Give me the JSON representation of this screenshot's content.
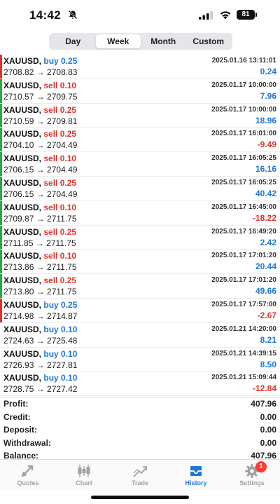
{
  "status_bar": {
    "time": "14:42",
    "battery": "81"
  },
  "period_tabs": [
    "Day",
    "Week",
    "Month",
    "Custom"
  ],
  "active_period": "Week",
  "colors": {
    "buy": "#1e78d6",
    "sell": "#e0322b",
    "profit_positive": "#1e78d6",
    "profit_negative": "#e0322b",
    "bar_green": "#2aa84a",
    "bar_red": "#e0322b",
    "active_tab": "#1e78d6"
  },
  "trades": [
    {
      "symbol": "XAUUSD,",
      "side": "buy",
      "volume": "0.25",
      "prices": "2708.82 → 2708.83",
      "time": "2025.01.16 13:11:01",
      "profit": "0.24",
      "bar": "red"
    },
    {
      "symbol": "XAUUSD,",
      "side": "sell",
      "volume": "0.10",
      "prices": "2710.57 → 2709.75",
      "time": "2025.01.17 10:00:00",
      "profit": "7.96",
      "bar": "green"
    },
    {
      "symbol": "XAUUSD,",
      "side": "sell",
      "volume": "0.25",
      "prices": "2710.59 → 2709.81",
      "time": "2025.01.17 10:00:00",
      "profit": "18.96",
      "bar": "green"
    },
    {
      "symbol": "XAUUSD,",
      "side": "sell",
      "volume": "0.25",
      "prices": "2704.10 → 2704.49",
      "time": "2025.01.17 16:01:00",
      "profit": "-9.49",
      "bar": "green"
    },
    {
      "symbol": "XAUUSD,",
      "side": "sell",
      "volume": "0.10",
      "prices": "2706.15 → 2704.49",
      "time": "2025.01.17 16:05:25",
      "profit": "16.16",
      "bar": "green"
    },
    {
      "symbol": "XAUUSD,",
      "side": "sell",
      "volume": "0.25",
      "prices": "2706.15 → 2704.49",
      "time": "2025.01.17 16:05:25",
      "profit": "40.42",
      "bar": "green"
    },
    {
      "symbol": "XAUUSD,",
      "side": "sell",
      "volume": "0.10",
      "prices": "2709.87 → 2711.75",
      "time": "2025.01.17 16:45:00",
      "profit": "-18.22",
      "bar": "green"
    },
    {
      "symbol": "XAUUSD,",
      "side": "sell",
      "volume": "0.25",
      "prices": "2711.85 → 2711.75",
      "time": "2025.01.17 16:49:20",
      "profit": "2.42",
      "bar": "green"
    },
    {
      "symbol": "XAUUSD,",
      "side": "sell",
      "volume": "0.10",
      "prices": "2713.86 → 2711.75",
      "time": "2025.01.17 17:01:20",
      "profit": "20.44",
      "bar": "green"
    },
    {
      "symbol": "XAUUSD,",
      "side": "sell",
      "volume": "0.25",
      "prices": "2713.80 → 2711.75",
      "time": "2025.01.17 17:01:20",
      "profit": "49.66",
      "bar": "green"
    },
    {
      "symbol": "XAUUSD,",
      "side": "buy",
      "volume": "0.25",
      "prices": "2714.98 → 2714.87",
      "time": "2025.01.17 17:57:00",
      "profit": "-2.67",
      "bar": "red"
    },
    {
      "symbol": "XAUUSD,",
      "side": "buy",
      "volume": "0.10",
      "prices": "2724.63 → 2725.48",
      "time": "2025.01.21 14:20:00",
      "profit": "8.21",
      "bar": "none"
    },
    {
      "symbol": "XAUUSD,",
      "side": "buy",
      "volume": "0.10",
      "prices": "2726.93 → 2727.81",
      "time": "2025.01.21 14:39:15",
      "profit": "8.50",
      "bar": "none"
    },
    {
      "symbol": "XAUUSD,",
      "side": "buy",
      "volume": "0.10",
      "prices": "2728.75 → 2727.42",
      "time": "2025.01.21 15:09:44",
      "profit": "-12.84",
      "bar": "none"
    }
  ],
  "summary": [
    {
      "label": "Profit:",
      "value": "407.96"
    },
    {
      "label": "Credit:",
      "value": "0.00"
    },
    {
      "label": "Deposit:",
      "value": "0.00"
    },
    {
      "label": "Withdrawal:",
      "value": "0.00"
    },
    {
      "label": "Balance:",
      "value": "407.96"
    }
  ],
  "tabbar": {
    "items": [
      {
        "label": "Quotes",
        "icon": "quotes-icon"
      },
      {
        "label": "Chart",
        "icon": "chart-icon"
      },
      {
        "label": "Trade",
        "icon": "trade-icon"
      },
      {
        "label": "History",
        "icon": "history-icon"
      },
      {
        "label": "Settings",
        "icon": "gear-icon"
      }
    ],
    "active": "History",
    "settings_badge": "1"
  }
}
